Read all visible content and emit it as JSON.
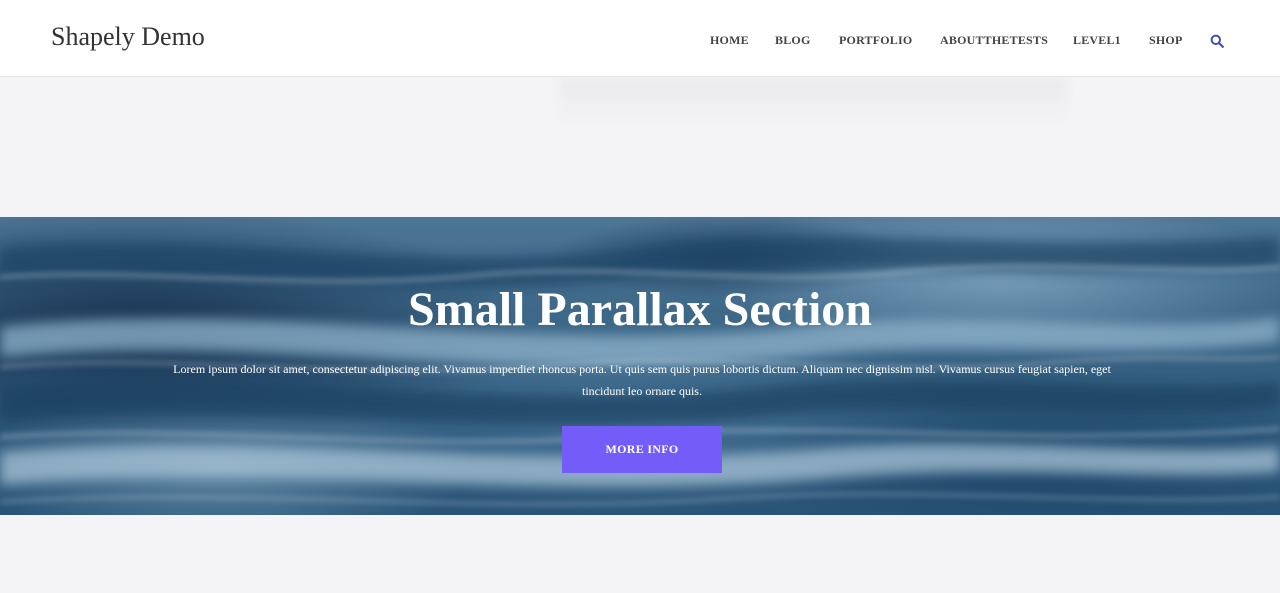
{
  "header": {
    "site_title": "Shapely Demo",
    "nav": [
      {
        "label": "HOME"
      },
      {
        "label": "BLOG"
      },
      {
        "label": "PORTFOLIO"
      },
      {
        "label": "ABOUTTHETESTS"
      },
      {
        "label": "LEVEL1"
      },
      {
        "label": "SHOP"
      }
    ],
    "search_icon": "search-icon"
  },
  "parallax": {
    "title": "Small Parallax Section",
    "body": "Lorem ipsum dolor sit amet, consectetur adipiscing elit. Vivamus imperdiet rhoncus porta. Ut quis sem quis purus lobortis dictum. Aliquam nec dignissim nisl. Vivamus cursus feugiat sapien, eget tincidunt leo ornare quis.",
    "button_label": "MORE INFO"
  },
  "colors": {
    "accent": "#745cf9",
    "search_icon": "#3f51b5",
    "page_background": "#f4f4f6",
    "header_background": "#ffffff"
  }
}
